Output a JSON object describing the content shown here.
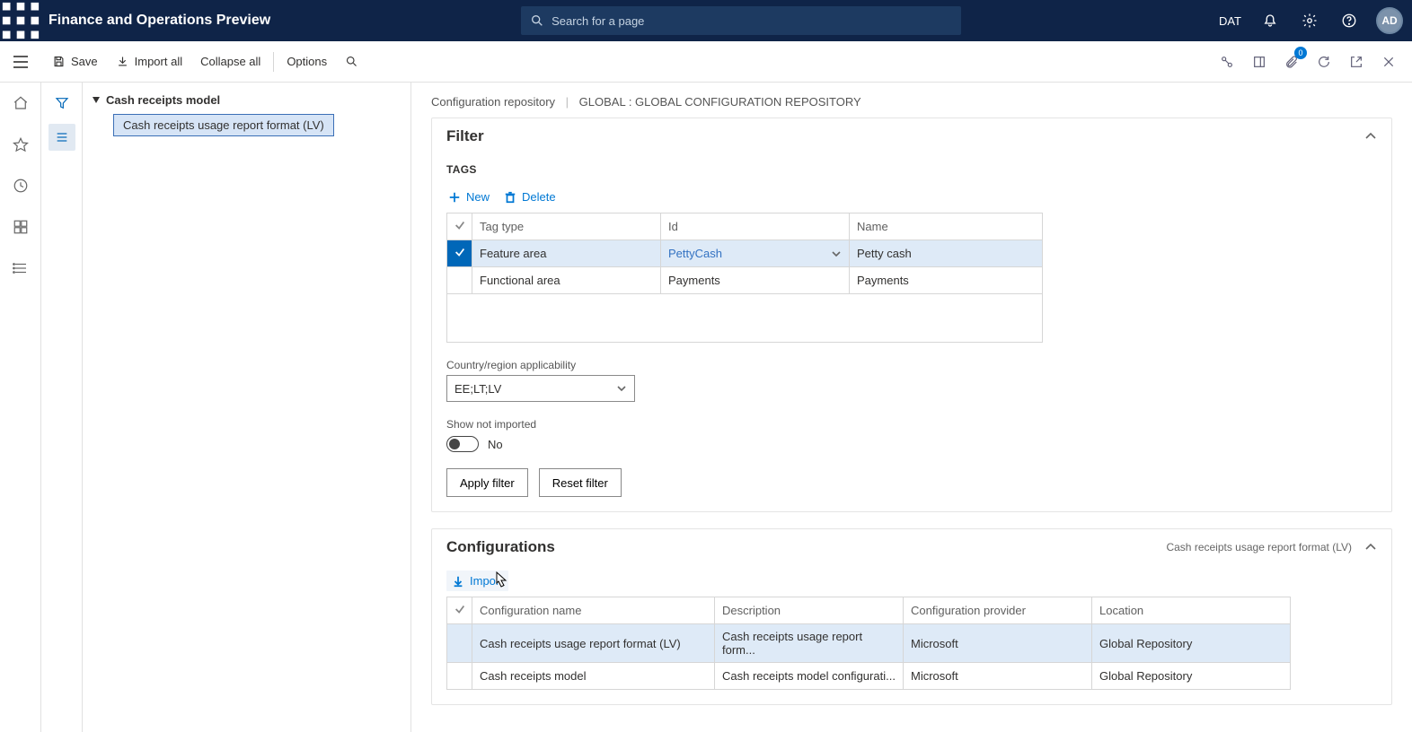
{
  "header": {
    "app_title": "Finance and Operations Preview",
    "search_placeholder": "Search for a page",
    "company": "DAT",
    "avatar": "AD"
  },
  "action_bar": {
    "save": "Save",
    "import_all": "Import all",
    "collapse_all": "Collapse all",
    "options": "Options",
    "badge_count": "0"
  },
  "tree": {
    "root": "Cash receipts model",
    "child": "Cash receipts usage report format (LV)"
  },
  "breadcrumb": {
    "a": "Configuration repository",
    "b": "GLOBAL : GLOBAL CONFIGURATION REPOSITORY"
  },
  "filter_panel": {
    "title": "Filter",
    "tags_label": "TAGS",
    "new_btn": "New",
    "delete_btn": "Delete",
    "cols": {
      "tag_type": "Tag type",
      "id": "Id",
      "name": "Name"
    },
    "rows": [
      {
        "tag_type": "Feature area",
        "id": "PettyCash",
        "name": "Petty cash"
      },
      {
        "tag_type": "Functional area",
        "id": "Payments",
        "name": "Payments"
      }
    ],
    "country_label": "Country/region applicability",
    "country_value": "EE;LT;LV",
    "show_not_imported_label": "Show not imported",
    "show_not_imported_value": "No",
    "apply": "Apply filter",
    "reset": "Reset filter"
  },
  "config_panel": {
    "title": "Configurations",
    "subtitle": "Cash receipts usage report format (LV)",
    "import_btn": "Import",
    "cols": {
      "name": "Configuration name",
      "desc": "Description",
      "provider": "Configuration provider",
      "location": "Location"
    },
    "rows": [
      {
        "name": "Cash receipts usage report format (LV)",
        "desc": "Cash receipts usage report form...",
        "provider": "Microsoft",
        "location": "Global Repository"
      },
      {
        "name": "Cash receipts model",
        "desc": "Cash receipts model configurati...",
        "provider": "Microsoft",
        "location": "Global Repository"
      }
    ]
  }
}
